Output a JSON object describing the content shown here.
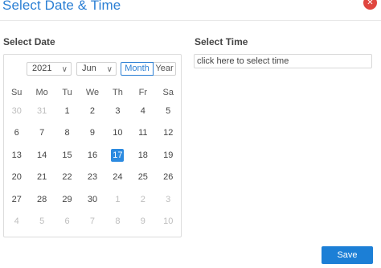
{
  "dialog": {
    "title": "Select Date & Time",
    "close_icon": "close-icon",
    "close_glyph": "✕"
  },
  "date_section": {
    "label": "Select Date"
  },
  "time_section": {
    "label": "Select Time",
    "placeholder": "click here to select time"
  },
  "calendar": {
    "year": "2021",
    "month": "Jun",
    "view_modes": [
      "Month",
      "Year"
    ],
    "active_view": "Month",
    "weekdays": [
      "Su",
      "Mo",
      "Tu",
      "We",
      "Th",
      "Fr",
      "Sa"
    ],
    "selected_day": "17",
    "weeks": [
      [
        {
          "d": "30",
          "o": true
        },
        {
          "d": "31",
          "o": true
        },
        {
          "d": "1"
        },
        {
          "d": "2"
        },
        {
          "d": "3"
        },
        {
          "d": "4"
        },
        {
          "d": "5"
        }
      ],
      [
        {
          "d": "6"
        },
        {
          "d": "7"
        },
        {
          "d": "8"
        },
        {
          "d": "9"
        },
        {
          "d": "10"
        },
        {
          "d": "11"
        },
        {
          "d": "12"
        }
      ],
      [
        {
          "d": "13"
        },
        {
          "d": "14"
        },
        {
          "d": "15"
        },
        {
          "d": "16"
        },
        {
          "d": "17",
          "s": true
        },
        {
          "d": "18"
        },
        {
          "d": "19"
        }
      ],
      [
        {
          "d": "20"
        },
        {
          "d": "21"
        },
        {
          "d": "22"
        },
        {
          "d": "23"
        },
        {
          "d": "24"
        },
        {
          "d": "25"
        },
        {
          "d": "26"
        }
      ],
      [
        {
          "d": "27"
        },
        {
          "d": "28"
        },
        {
          "d": "29"
        },
        {
          "d": "30"
        },
        {
          "d": "1",
          "o": true
        },
        {
          "d": "2",
          "o": true
        },
        {
          "d": "3",
          "o": true
        }
      ],
      [
        {
          "d": "4",
          "o": true
        },
        {
          "d": "5",
          "o": true
        },
        {
          "d": "6",
          "o": true
        },
        {
          "d": "7",
          "o": true
        },
        {
          "d": "8",
          "o": true
        },
        {
          "d": "9",
          "o": true
        },
        {
          "d": "10",
          "o": true
        }
      ]
    ]
  },
  "actions": {
    "save_label": "Save"
  },
  "colors": {
    "accent": "#2b7fd4",
    "close": "#e0463f",
    "selected": "#2b8ae0",
    "save": "#1c7fd6"
  }
}
